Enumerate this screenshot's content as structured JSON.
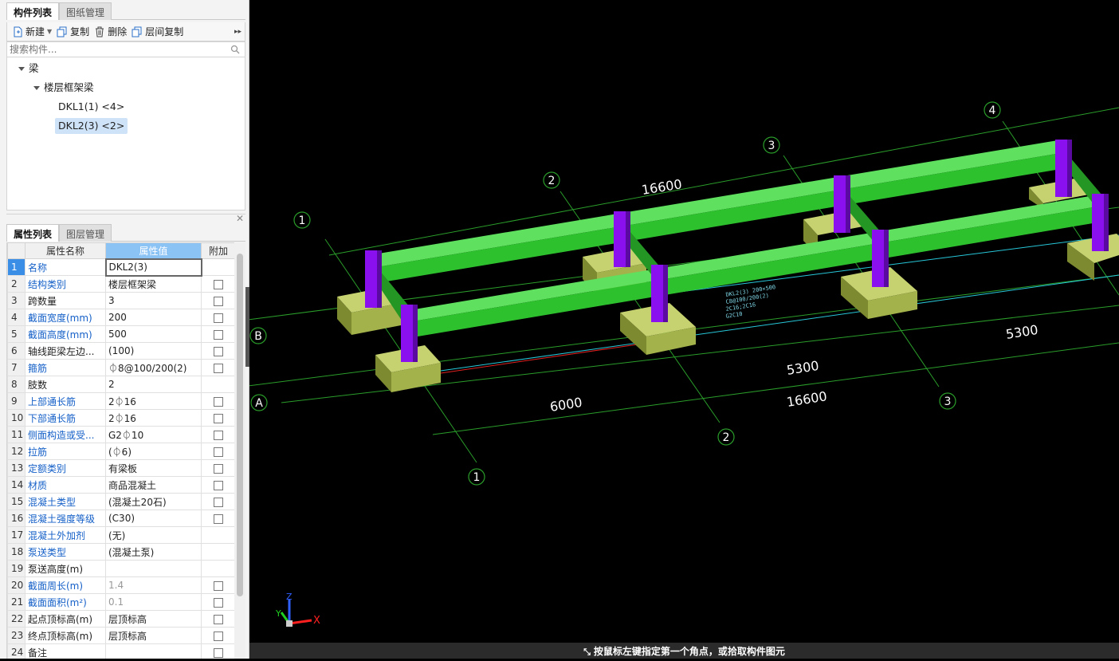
{
  "left_panel": {
    "top_tabs": [
      "构件列表",
      "图纸管理"
    ],
    "toolbar": {
      "new_label": "新建",
      "copy_label": "复制",
      "delete_label": "删除",
      "floor_copy_label": "层间复制",
      "more_label": "▸▸"
    },
    "search": {
      "placeholder": "搜索构件..."
    },
    "tree": {
      "root": "梁",
      "group": "楼层框架梁",
      "items": [
        "DKL1(1) <4>",
        "DKL2(3) <2>"
      ]
    },
    "bottom_tabs": [
      "属性列表",
      "图层管理"
    ],
    "props": {
      "headers": [
        "属性名称",
        "属性值",
        "附加"
      ],
      "rows": [
        {
          "n": "1",
          "name": "名称",
          "value": "DKL2(3)",
          "blue": true,
          "check": false
        },
        {
          "n": "2",
          "name": "结构类别",
          "value": "楼层框架梁",
          "blue": true,
          "check": true
        },
        {
          "n": "3",
          "name": "跨数量",
          "value": "3",
          "blue": false,
          "check": true
        },
        {
          "n": "4",
          "name": "截面宽度(mm)",
          "value": "200",
          "blue": true,
          "check": true
        },
        {
          "n": "5",
          "name": "截面高度(mm)",
          "value": "500",
          "blue": true,
          "check": true
        },
        {
          "n": "6",
          "name": "轴线距梁左边...",
          "value": "(100)",
          "blue": false,
          "check": true
        },
        {
          "n": "7",
          "name": "箍筋",
          "value": "⏀8@100/200(2)",
          "blue": true,
          "check": true
        },
        {
          "n": "8",
          "name": "肢数",
          "value": "2",
          "blue": false,
          "check": false
        },
        {
          "n": "9",
          "name": "上部通长筋",
          "value": "2⏀16",
          "blue": true,
          "check": true
        },
        {
          "n": "10",
          "name": "下部通长筋",
          "value": "2⏀16",
          "blue": true,
          "check": true
        },
        {
          "n": "11",
          "name": "侧面构造或受...",
          "value": "G2⏀10",
          "blue": true,
          "check": true
        },
        {
          "n": "12",
          "name": "拉筋",
          "value": "(⏀6)",
          "blue": true,
          "check": true
        },
        {
          "n": "13",
          "name": "定额类别",
          "value": "有梁板",
          "blue": true,
          "check": true
        },
        {
          "n": "14",
          "name": "材质",
          "value": "商品混凝土",
          "blue": true,
          "check": true
        },
        {
          "n": "15",
          "name": "混凝土类型",
          "value": "(混凝土20石)",
          "blue": true,
          "check": true
        },
        {
          "n": "16",
          "name": "混凝土强度等级",
          "value": "(C30)",
          "blue": true,
          "check": true
        },
        {
          "n": "17",
          "name": "混凝土外加剂",
          "value": "(无)",
          "blue": true,
          "check": false
        },
        {
          "n": "18",
          "name": "泵送类型",
          "value": "(混凝土泵)",
          "blue": true,
          "check": false
        },
        {
          "n": "19",
          "name": "泵送高度(m)",
          "value": "",
          "blue": false,
          "check": false
        },
        {
          "n": "20",
          "name": "截面周长(m)",
          "value": "1.4",
          "blue": true,
          "check": true,
          "gray": true
        },
        {
          "n": "21",
          "name": "截面面积(m²)",
          "value": "0.1",
          "blue": true,
          "check": true,
          "gray": true
        },
        {
          "n": "22",
          "name": "起点顶标高(m)",
          "value": "层顶标高",
          "blue": false,
          "check": true
        },
        {
          "n": "23",
          "name": "终点顶标高(m)",
          "value": "层顶标高",
          "blue": false,
          "check": true
        },
        {
          "n": "24",
          "name": "备注",
          "value": "",
          "blue": false,
          "check": true
        }
      ]
    }
  },
  "viewport": {
    "axis_numbers": [
      "1",
      "2",
      "3",
      "4"
    ],
    "axis_letters": [
      "A",
      "B"
    ],
    "dimensions": {
      "top_total": "16600",
      "bottom_total": "16600",
      "span_1": "6000",
      "span_2": "5300",
      "span_3": "5300",
      "top_span_1": "6000",
      "top_span_2": "5300",
      "top_span_3": "5300"
    },
    "beam_annotation": [
      "DKL2(3) 200×500",
      "C8@100/200(2)",
      "2C16;2C16",
      "G2C10"
    ],
    "beam_annotation_2": [
      "DKL2(3)",
      "200×500",
      "C8@100"
    ],
    "ucs": {
      "x": "X",
      "y": "Y",
      "z": "Z"
    },
    "colors": {
      "beam": "#2ec12e",
      "column": "#8a10f0",
      "footing": "#aabb55",
      "grid": "#2a9d2a"
    }
  },
  "status": {
    "message": "按鼠标左键指定第一个角点，或拾取构件图元"
  }
}
